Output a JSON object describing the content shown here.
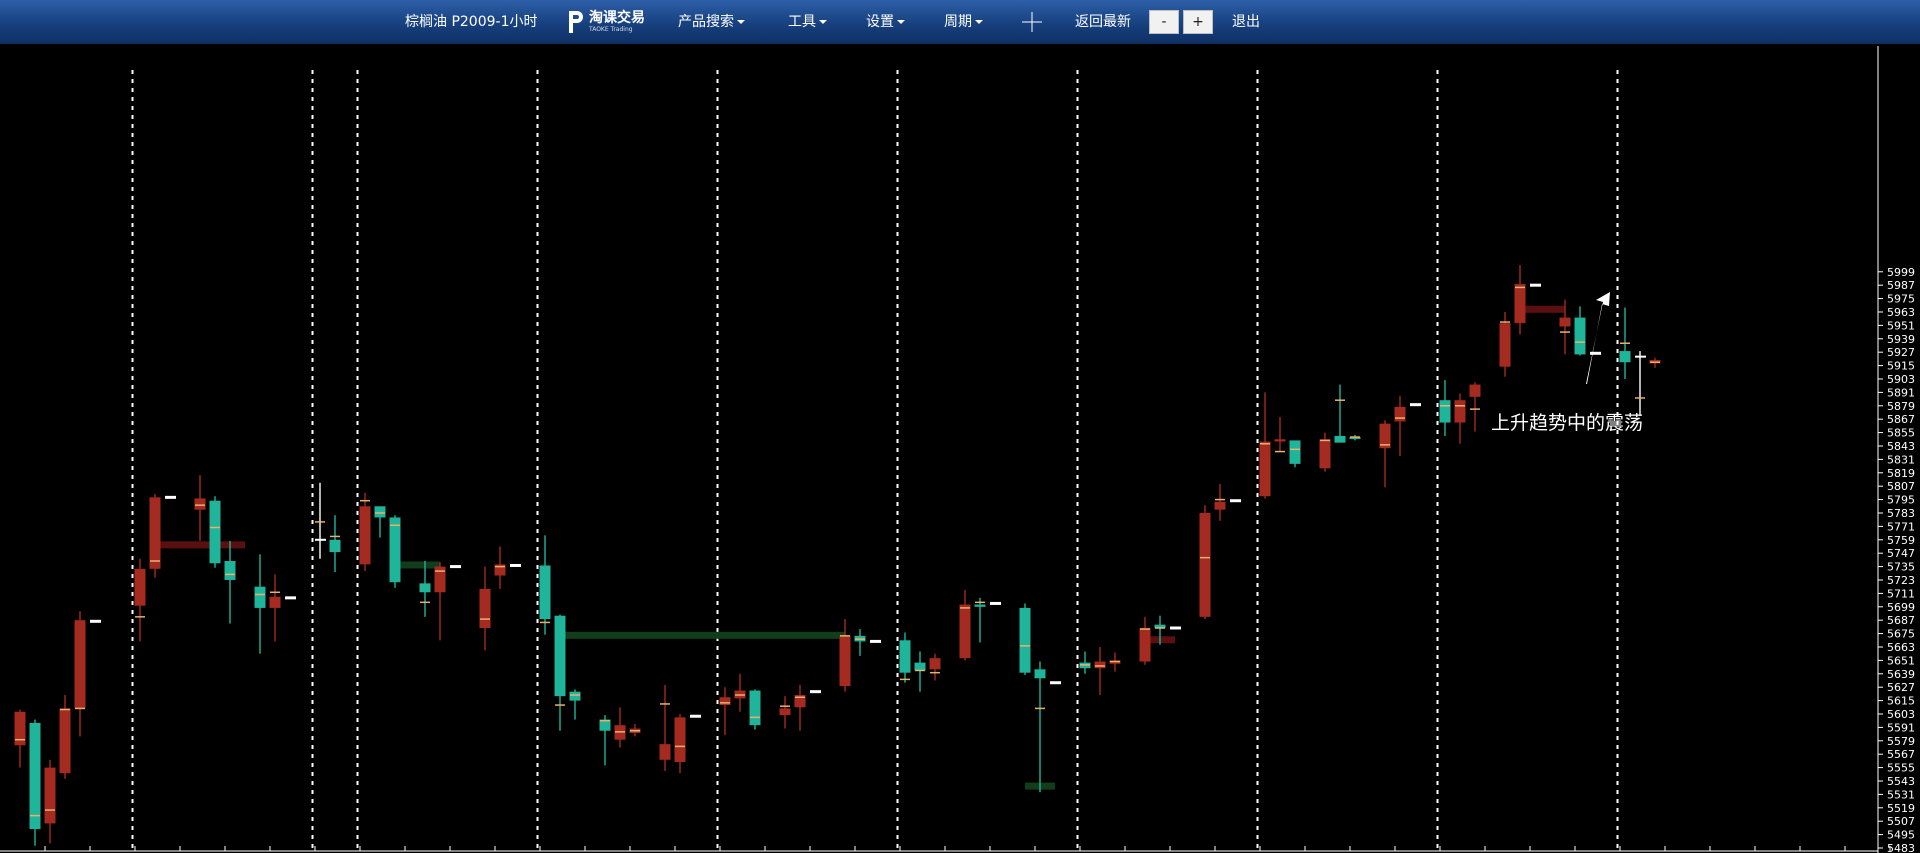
{
  "toolbar": {
    "title": "棕榈油 P2009-1小时",
    "logo_text": "淘课交易",
    "logo_subtext": "TAOKE Trading",
    "product_search": "产品搜索",
    "tools": "工具",
    "settings": "设置",
    "period": "周期",
    "back_latest": "返回最新",
    "zoom_out": "-",
    "zoom_in": "+",
    "exit": "退出"
  },
  "colors": {
    "up": "#a52a20",
    "down": "#1fb59a",
    "header": "#1d4a8c",
    "background": "#000000",
    "marker": "#ffffff",
    "zone_green": "#113d1a",
    "zone_red": "#5a1010"
  },
  "chart_data": {
    "type": "candlestick",
    "instrument": "棕榈油 P2009",
    "period": "1小时",
    "ylim": [
      5483,
      6015
    ],
    "yticks": [
      5483,
      5495,
      5507,
      5519,
      5531,
      5543,
      5555,
      5567,
      5579,
      5591,
      5603,
      5615,
      5627,
      5639,
      5651,
      5663,
      5675,
      5687,
      5699,
      5711,
      5723,
      5735,
      5747,
      5759,
      5771,
      5783,
      5795,
      5807,
      5819,
      5831,
      5843,
      5855,
      5867,
      5879,
      5891,
      5903,
      5915,
      5927,
      5939,
      5951,
      5963,
      5975,
      5987,
      5999
    ],
    "annotation": "上升趋势中的震荡",
    "candles": [
      {
        "slot": 0,
        "o": 5575,
        "h": 5607,
        "l": 5555,
        "c": 5605,
        "mid": 5580
      },
      {
        "slot": 1,
        "o": 5595,
        "h": 5598,
        "l": 5485,
        "c": 5500,
        "mid": 5512
      },
      {
        "slot": 2,
        "o": 5505,
        "h": 5562,
        "l": 5487,
        "c": 5555,
        "mid": 5517
      },
      {
        "slot": 3,
        "o": 5550,
        "h": 5620,
        "l": 5545,
        "c": 5608,
        "mid": 5607
      },
      {
        "slot": 4,
        "o": 5608,
        "h": 5695,
        "l": 5583,
        "c": 5687,
        "mid": 5608
      },
      {
        "slot": 5,
        "marker": 5686
      },
      {
        "slot": 8,
        "o": 5700,
        "h": 5742,
        "l": 5668,
        "c": 5733,
        "mid": 5690
      },
      {
        "slot": 9,
        "o": 5733,
        "h": 5800,
        "l": 5725,
        "c": 5797,
        "mid": 5740
      },
      {
        "slot": 10,
        "marker": 5797
      },
      {
        "slot": 12,
        "o": 5786,
        "h": 5817,
        "l": 5758,
        "c": 5796,
        "mid": 5790
      },
      {
        "slot": 13,
        "o": 5794,
        "h": 5798,
        "l": 5734,
        "c": 5738,
        "mid": 5770
      },
      {
        "slot": 14,
        "o": 5740,
        "h": 5758,
        "l": 5684,
        "c": 5723,
        "mid": 5728
      },
      {
        "slot": 16,
        "o": 5717,
        "h": 5746,
        "l": 5657,
        "c": 5698,
        "mid": 5710
      },
      {
        "slot": 17,
        "o": 5698,
        "h": 5728,
        "l": 5668,
        "c": 5708,
        "mid": 5712
      },
      {
        "slot": 18,
        "marker": 5707
      },
      {
        "slot": 20,
        "o": 5760,
        "h": 5810,
        "l": 5742,
        "c": 5759,
        "mid": 5775,
        "white": true
      },
      {
        "slot": 21,
        "o": 5759,
        "h": 5781,
        "l": 5730,
        "c": 5748,
        "mid": 5762
      },
      {
        "slot": 23,
        "o": 5737,
        "h": 5801,
        "l": 5731,
        "c": 5789,
        "mid": 5794
      },
      {
        "slot": 24,
        "o": 5789,
        "h": 5788,
        "l": 5761,
        "c": 5779,
        "mid": 5783
      },
      {
        "slot": 25,
        "o": 5779,
        "h": 5781,
        "l": 5716,
        "c": 5721,
        "mid": 5772
      },
      {
        "slot": 27,
        "o": 5720,
        "h": 5740,
        "l": 5690,
        "c": 5712,
        "mid": 5703
      },
      {
        "slot": 28,
        "o": 5712,
        "h": 5739,
        "l": 5669,
        "c": 5735,
        "mid": 5731
      },
      {
        "slot": 29,
        "marker": 5735
      },
      {
        "slot": 31,
        "o": 5680,
        "h": 5735,
        "l": 5660,
        "c": 5715,
        "mid": 5688
      },
      {
        "slot": 32,
        "o": 5727,
        "h": 5753,
        "l": 5715,
        "c": 5737,
        "mid": 5735
      },
      {
        "slot": 33,
        "marker": 5736
      },
      {
        "slot": 35,
        "o": 5736,
        "h": 5763,
        "l": 5674,
        "c": 5688,
        "mid": 5685
      },
      {
        "slot": 36,
        "o": 5691,
        "h": 5692,
        "l": 5588,
        "c": 5619,
        "mid": 5611
      },
      {
        "slot": 37,
        "o": 5623,
        "h": 5625,
        "l": 5598,
        "c": 5615,
        "mid": 5620
      },
      {
        "slot": 39,
        "o": 5598,
        "h": 5602,
        "l": 5557,
        "c": 5588,
        "mid": 5597
      },
      {
        "slot": 40,
        "o": 5580,
        "h": 5609,
        "l": 5573,
        "c": 5593,
        "mid": 5587
      },
      {
        "slot": 41,
        "o": 5586,
        "h": 5594,
        "l": 5583,
        "c": 5590,
        "mid": 5588
      },
      {
        "slot": 43,
        "o": 5562,
        "h": 5629,
        "l": 5552,
        "c": 5576,
        "mid": 5612
      },
      {
        "slot": 44,
        "o": 5560,
        "h": 5603,
        "l": 5550,
        "c": 5600,
        "mid": 5574
      },
      {
        "slot": 45,
        "marker": 5601
      },
      {
        "slot": 47,
        "o": 5611,
        "h": 5627,
        "l": 5584,
        "c": 5618,
        "mid": 5613
      },
      {
        "slot": 48,
        "o": 5617,
        "h": 5639,
        "l": 5605,
        "c": 5624,
        "mid": 5620
      },
      {
        "slot": 49,
        "o": 5624,
        "h": 5625,
        "l": 5589,
        "c": 5593,
        "mid": 5600
      },
      {
        "slot": 51,
        "o": 5602,
        "h": 5619,
        "l": 5590,
        "c": 5608,
        "mid": 5610
      },
      {
        "slot": 52,
        "o": 5609,
        "h": 5629,
        "l": 5588,
        "c": 5620,
        "mid": 5618
      },
      {
        "slot": 53,
        "marker": 5623
      },
      {
        "slot": 55,
        "o": 5628,
        "h": 5688,
        "l": 5623,
        "c": 5673,
        "mid": 5673
      },
      {
        "slot": 56,
        "o": 5673,
        "h": 5679,
        "l": 5655,
        "c": 5668,
        "mid": 5670
      },
      {
        "slot": 57,
        "marker": 5668
      },
      {
        "slot": 59,
        "o": 5669,
        "h": 5676,
        "l": 5631,
        "c": 5640,
        "mid": 5634
      },
      {
        "slot": 60,
        "o": 5649,
        "h": 5659,
        "l": 5623,
        "c": 5642,
        "mid": 5642
      },
      {
        "slot": 61,
        "o": 5643,
        "h": 5657,
        "l": 5633,
        "c": 5653,
        "mid": 5640
      },
      {
        "slot": 63,
        "o": 5653,
        "h": 5714,
        "l": 5651,
        "c": 5701,
        "mid": 5698
      },
      {
        "slot": 64,
        "o": 5701,
        "h": 5707,
        "l": 5667,
        "c": 5699,
        "mid": 5703
      },
      {
        "slot": 65,
        "marker": 5702
      },
      {
        "slot": 67,
        "o": 5698,
        "h": 5702,
        "l": 5638,
        "c": 5640,
        "mid": 5664
      },
      {
        "slot": 68,
        "o": 5643,
        "h": 5650,
        "l": 5533,
        "c": 5635,
        "mid": 5608
      },
      {
        "slot": 69,
        "marker": 5631
      },
      {
        "slot": 71,
        "o": 5649,
        "h": 5659,
        "l": 5639,
        "c": 5644,
        "mid": 5647
      },
      {
        "slot": 72,
        "o": 5644,
        "h": 5663,
        "l": 5620,
        "c": 5650,
        "mid": 5646
      },
      {
        "slot": 73,
        "o": 5648,
        "h": 5658,
        "l": 5641,
        "c": 5651,
        "mid": 5650
      },
      {
        "slot": 75,
        "o": 5650,
        "h": 5690,
        "l": 5647,
        "c": 5680,
        "mid": 5679
      },
      {
        "slot": 76,
        "o": 5683,
        "h": 5691,
        "l": 5665,
        "c": 5680,
        "mid": 5680
      },
      {
        "slot": 77,
        "marker": 5680
      },
      {
        "slot": 79,
        "o": 5690,
        "h": 5790,
        "l": 5688,
        "c": 5783,
        "mid": 5743
      },
      {
        "slot": 80,
        "o": 5786,
        "h": 5809,
        "l": 5776,
        "c": 5793,
        "mid": 5795
      },
      {
        "slot": 81,
        "marker": 5794
      },
      {
        "slot": 83,
        "o": 5798,
        "h": 5891,
        "l": 5796,
        "c": 5847,
        "mid": 5845
      },
      {
        "slot": 84,
        "o": 5847,
        "h": 5869,
        "l": 5838,
        "c": 5849,
        "mid": 5838
      },
      {
        "slot": 85,
        "o": 5848,
        "h": 5846,
        "l": 5824,
        "c": 5827,
        "mid": 5840
      },
      {
        "slot": 87,
        "o": 5823,
        "h": 5855,
        "l": 5820,
        "c": 5849,
        "mid": 5848
      },
      {
        "slot": 88,
        "o": 5852,
        "h": 5898,
        "l": 5846,
        "c": 5846,
        "mid": 5884
      },
      {
        "slot": 89,
        "o": 5851,
        "h": 5853,
        "l": 5848,
        "c": 5850,
        "mid": 5851
      },
      {
        "slot": 91,
        "o": 5841,
        "h": 5866,
        "l": 5806,
        "c": 5863,
        "mid": 5844
      },
      {
        "slot": 92,
        "o": 5865,
        "h": 5888,
        "l": 5834,
        "c": 5878,
        "mid": 5868
      },
      {
        "slot": 93,
        "marker": 5880
      },
      {
        "slot": 95,
        "o": 5884,
        "h": 5902,
        "l": 5852,
        "c": 5864,
        "mid": 5879
      },
      {
        "slot": 96,
        "o": 5864,
        "h": 5890,
        "l": 5845,
        "c": 5884,
        "mid": 5879
      },
      {
        "slot": 97,
        "o": 5887,
        "h": 5900,
        "l": 5856,
        "c": 5898,
        "mid": 5876
      },
      {
        "slot": 99,
        "o": 5914,
        "h": 5963,
        "l": 5905,
        "c": 5953,
        "mid": 5954
      },
      {
        "slot": 100,
        "o": 5953,
        "h": 6005,
        "l": 5943,
        "c": 5988,
        "mid": 5985
      },
      {
        "slot": 101,
        "marker": 5987
      },
      {
        "slot": 103,
        "o": 5950,
        "h": 5974,
        "l": 5925,
        "c": 5958,
        "mid": 5945
      },
      {
        "slot": 104,
        "o": 5958,
        "h": 5968,
        "l": 5924,
        "c": 5925,
        "mid": 5936
      },
      {
        "slot": 105,
        "marker": 5926
      },
      {
        "slot": 107,
        "o": 5928,
        "h": 5967,
        "l": 5903,
        "c": 5918,
        "mid": 5935
      },
      {
        "slot": 108,
        "o": 5918,
        "h": 5928,
        "l": 5870,
        "c": 5923,
        "mid": 5886,
        "white": true
      },
      {
        "slot": 109,
        "o": 5917,
        "h": 5922,
        "l": 5913,
        "c": 5920,
        "mid": 5918
      }
    ],
    "zones": [
      {
        "from_slot": 9,
        "to_slot": 15,
        "price": 5754,
        "color": "red"
      },
      {
        "from_slot": 25,
        "to_slot": 28,
        "price": 5736,
        "color": "green"
      },
      {
        "from_slot": 36,
        "to_slot": 55,
        "price": 5673,
        "color": "green"
      },
      {
        "from_slot": 67,
        "to_slot": 69,
        "price": 5538,
        "color": "green"
      },
      {
        "from_slot": 75,
        "to_slot": 77,
        "price": 5669,
        "color": "red"
      },
      {
        "from_slot": 100,
        "to_slot": 103,
        "price": 5965,
        "color": "red"
      }
    ],
    "session_breaks": [
      7.5,
      19.5,
      22.5,
      34.5,
      46.5,
      58.5,
      70.5,
      82.5,
      94.5,
      106.5
    ]
  }
}
